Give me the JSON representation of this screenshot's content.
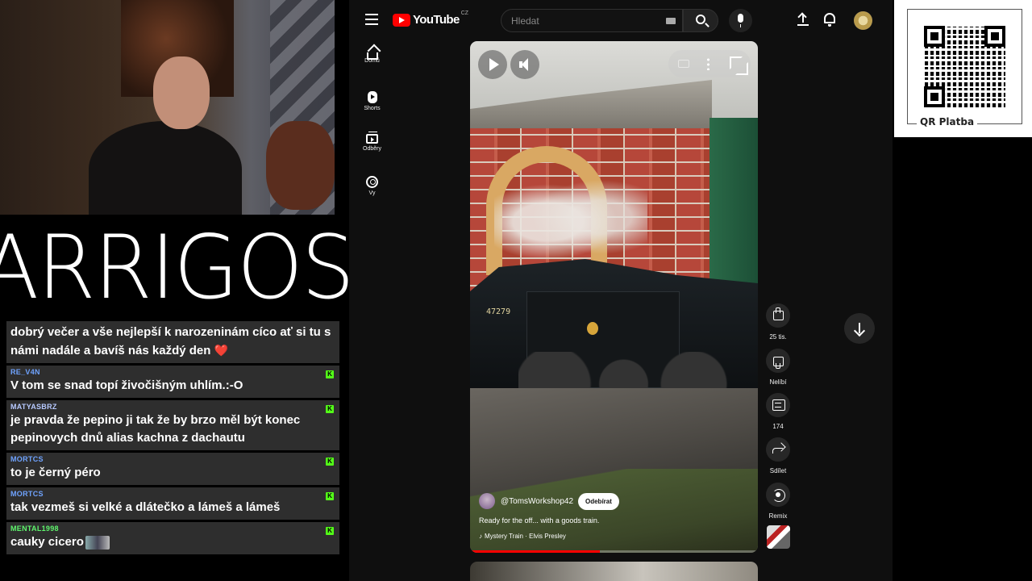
{
  "stream": {
    "logo_text": "ARRIGOS"
  },
  "chat": {
    "messages": [
      {
        "user": "",
        "text": "dobrý večer a vše nejlepší k narozeninám cíco ať si tu s námi nadále a bavíš nás každý den",
        "suffix": "❤️",
        "user_color": ""
      },
      {
        "user": "RE_V4N",
        "text": "V tom se snad topí živočišným uhlím.:-O",
        "user_color": "#6fa3ff"
      },
      {
        "user": "MATYASBRZ",
        "text": "je pravda že pepino ji tak že by brzo měl být konec pepinovych dnů alias kachna z dachautu",
        "user_color": "#b7c9ff"
      },
      {
        "user": "MORTCS",
        "text": "to je černý péro",
        "user_color": "#6fa3ff"
      },
      {
        "user": "MORTCS",
        "text": "tak vezmeš si velké a dlátečko a lámeš a lámeš",
        "user_color": "#6fa3ff"
      },
      {
        "user": "MENTAL1998",
        "text": "cauky cicero",
        "user_color": "#5ff56d"
      }
    ],
    "badge_icon": "kick-badge-icon"
  },
  "youtube": {
    "brand": "YouTube",
    "country": "CZ",
    "search_placeholder": "Hledat",
    "sidebar": [
      {
        "label": "Domů",
        "icon": "home-icon"
      },
      {
        "label": "Shorts",
        "icon": "shorts-icon"
      },
      {
        "label": "Odběry",
        "icon": "subscriptions-icon"
      },
      {
        "label": "Vy",
        "icon": "you-icon"
      }
    ],
    "short": {
      "channel": "@TomsWorkshop42",
      "subscribe_label": "Odebírat",
      "title": "Ready for the off... with a goods train.",
      "music": "Mystery Train · Elvis Presley",
      "loco_number": "47279",
      "progress": 0.45
    },
    "actions": {
      "likes": "25 tis.",
      "dislike_label": "Nelíbí",
      "comments": "174",
      "share_label": "Sdílet",
      "remix_label": "Remix"
    }
  },
  "qr": {
    "label": "QR Platba"
  }
}
